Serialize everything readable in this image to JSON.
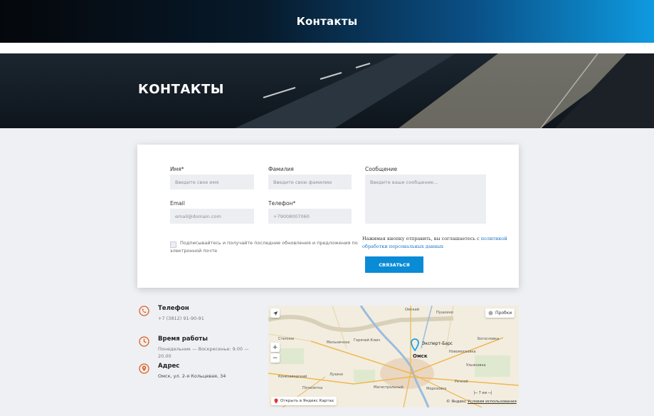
{
  "header": {
    "title": "Контакты"
  },
  "hero": {
    "heading": "КОНТАКТЫ"
  },
  "form": {
    "first_name": {
      "label": "Имя*",
      "placeholder": "Введите свое имя"
    },
    "last_name": {
      "label": "Фамилия",
      "placeholder": "Введите свою фамилию"
    },
    "message": {
      "label": "Сообщение",
      "placeholder": "Введите ваше сообщение..."
    },
    "email": {
      "label": "Email",
      "placeholder": "email@domain.com"
    },
    "phone": {
      "label": "Телефон*",
      "placeholder": "+79008007060"
    },
    "subscribe_line1": "Подписывайтесь и получайте последние обновления и предложения по",
    "subscribe_line2": "электронной почте",
    "consent_text": "Нажимая кнопку отправить, вы соглашаетесь с ",
    "consent_link_1": "политикой",
    "consent_link_2": "обработки персональных данных",
    "submit_label": "СВЯЗАТЬСЯ"
  },
  "contacts": {
    "phone": {
      "title": "Телефон",
      "value": "+7 (3812) 91-90-91"
    },
    "hours": {
      "title": "Время работы",
      "line1": "Понедельник — Воскресенье: 9.00 —",
      "line2": "20.00"
    },
    "address": {
      "title": "Адрес",
      "value": "Омск, ул. 2-я Кольцевая, 34"
    }
  },
  "map": {
    "traffic_label": "Пробки",
    "open_label": "Открыть в Яндекс Картах",
    "copyright": "© Яндекс",
    "terms": "Условия использования",
    "scale": "7 км",
    "marker_label": "Эксперт-Барс",
    "city": "Омск",
    "places": [
      "Омский",
      "Пушкино",
      "Богословка",
      "Степное",
      "Мельничное",
      "Горячий Ключ",
      "Новомосковка",
      "Ульяновка",
      "Лузино",
      "Конезаводский",
      "Пятилетка",
      "Магистральный",
      "Морозовка",
      "Речной"
    ],
    "colors": {
      "accent": "#0a8bd6",
      "icon": "#e25d1d"
    }
  }
}
